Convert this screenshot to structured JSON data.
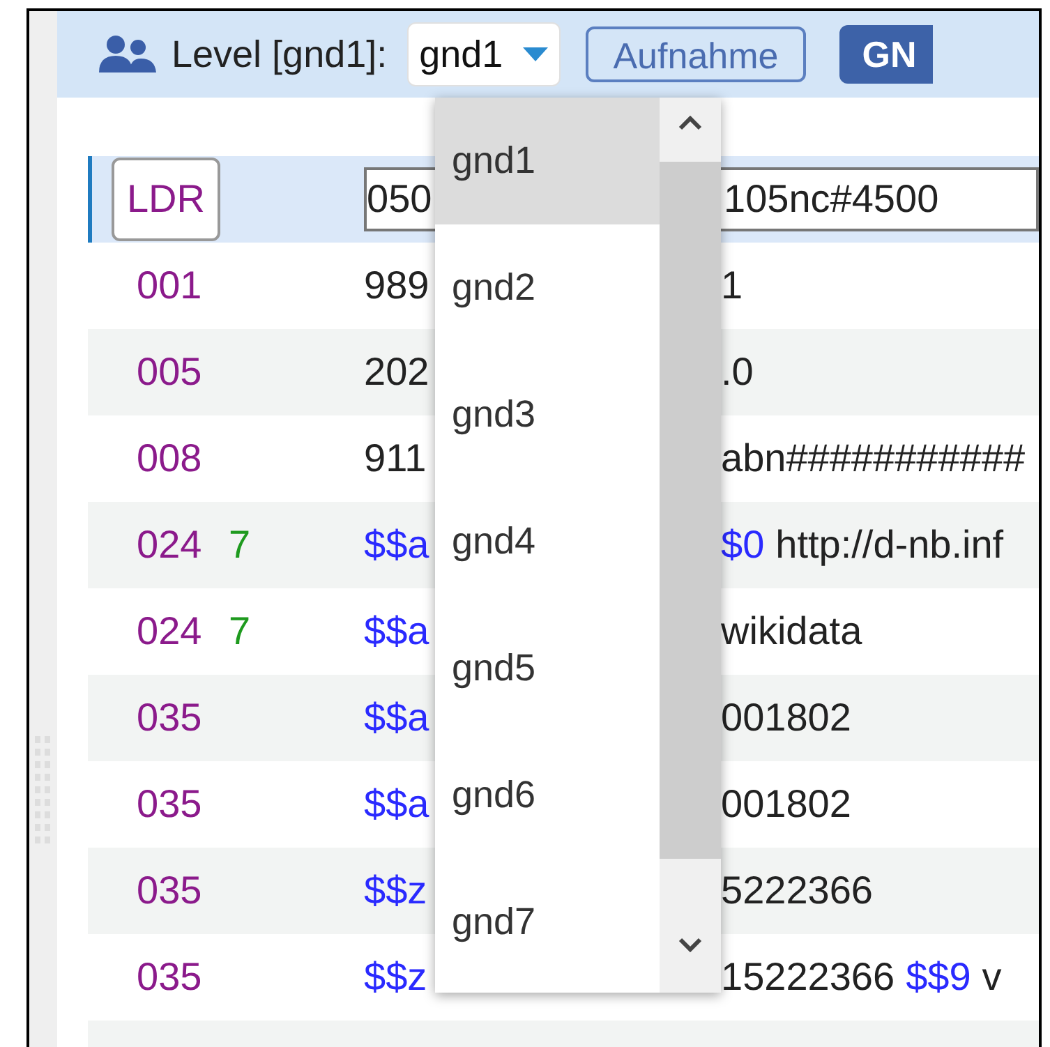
{
  "toolbar": {
    "level_label": "Level [gnd1]:",
    "level_select": {
      "value": "gnd1",
      "expanded": true
    },
    "buttons": [
      {
        "label": "Aufnahme",
        "kind": "outline"
      },
      {
        "label": "GN",
        "kind": "solid"
      }
    ]
  },
  "dropdown": {
    "options": [
      {
        "label": "gnd1",
        "selected": true
      },
      {
        "label": "gnd2",
        "selected": false
      },
      {
        "label": "gnd3",
        "selected": false
      },
      {
        "label": "gnd4",
        "selected": false
      },
      {
        "label": "gnd5",
        "selected": false
      },
      {
        "label": "gnd6",
        "selected": false
      },
      {
        "label": "gnd7",
        "selected": false
      }
    ]
  },
  "rows": [
    {
      "kind": "leader",
      "tag": "LDR",
      "selected": true,
      "start": [
        {
          "kind": "text",
          "text": "050"
        }
      ],
      "end": [
        {
          "kind": "text",
          "text": "105nc#4500"
        }
      ]
    },
    {
      "kind": "field",
      "tag": "001",
      "selected": false,
      "start": [
        {
          "kind": "text",
          "text": "989"
        }
      ],
      "end": [
        {
          "kind": "text",
          "text": "1"
        }
      ]
    },
    {
      "kind": "field",
      "tag": "005",
      "selected": false,
      "start": [
        {
          "kind": "text",
          "text": "202"
        }
      ],
      "end": [
        {
          "kind": "text",
          "text": ".0"
        }
      ]
    },
    {
      "kind": "field",
      "tag": "008",
      "selected": false,
      "start": [
        {
          "kind": "text",
          "text": "911"
        }
      ],
      "end": [
        {
          "kind": "text",
          "text": "abn###########"
        }
      ]
    },
    {
      "kind": "field",
      "tag": "024",
      "indicator": "7",
      "selected": false,
      "start": [
        {
          "kind": "code",
          "text": "$$a"
        }
      ],
      "end": [
        {
          "kind": "code",
          "text": "$0"
        },
        {
          "kind": "text",
          "text": "http://d-nb.inf"
        }
      ]
    },
    {
      "kind": "field",
      "tag": "024",
      "indicator": "7",
      "selected": false,
      "start": [
        {
          "kind": "code",
          "text": "$$a"
        }
      ],
      "end": [
        {
          "kind": "text",
          "text": "wikidata"
        }
      ]
    },
    {
      "kind": "field",
      "tag": "035",
      "selected": false,
      "start": [
        {
          "kind": "code",
          "text": "$$a"
        }
      ],
      "end": [
        {
          "kind": "text",
          "text": "001802"
        }
      ]
    },
    {
      "kind": "field",
      "tag": "035",
      "selected": false,
      "start": [
        {
          "kind": "code",
          "text": "$$a"
        }
      ],
      "end": [
        {
          "kind": "text",
          "text": "001802"
        }
      ]
    },
    {
      "kind": "field",
      "tag": "035",
      "selected": false,
      "start": [
        {
          "kind": "code",
          "text": "$$z"
        }
      ],
      "end": [
        {
          "kind": "text",
          "text": "5222366"
        }
      ]
    },
    {
      "kind": "field",
      "tag": "035",
      "selected": false,
      "start": [
        {
          "kind": "code",
          "text": "$$z"
        }
      ],
      "end": [
        {
          "kind": "text",
          "text": "15222366"
        },
        {
          "kind": "code",
          "text": "$$9"
        },
        {
          "kind": "text",
          "text": "v"
        }
      ]
    }
  ]
}
